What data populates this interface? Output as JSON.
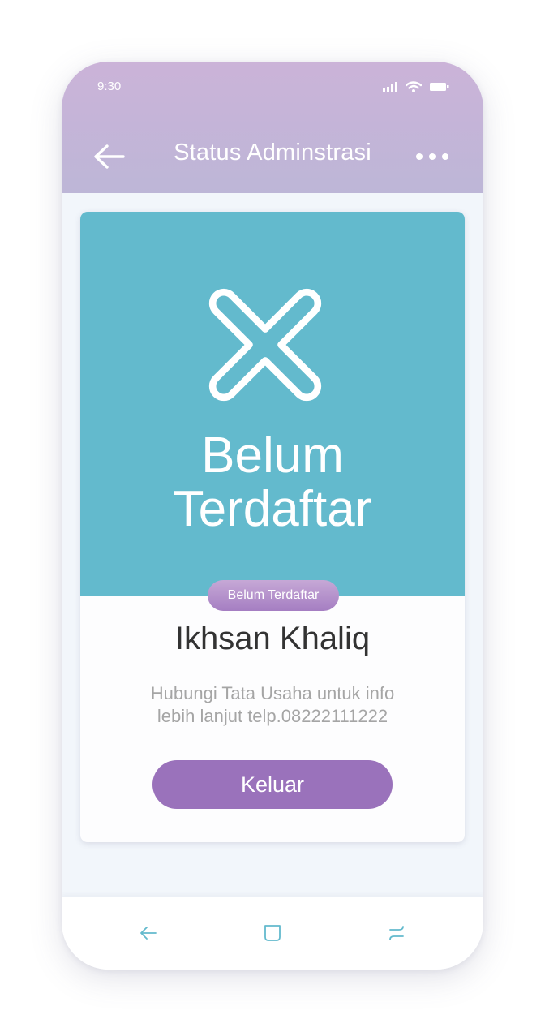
{
  "status_bar": {
    "time": "9:30",
    "icons": [
      "signal-icon",
      "wifi-icon",
      "battery-icon"
    ]
  },
  "header": {
    "title": "Status Adminstrasi",
    "back_icon": "arrow-left-icon",
    "menu_icon": "more-dots-icon"
  },
  "card": {
    "status_icon": "x-mark-icon",
    "status_title_line1": "Belum",
    "status_title_line2": "Terdaftar",
    "badge": "Belum Terdaftar",
    "user_name": "Ikhsan Khaliq",
    "info_line1": "Hubungi Tata Usaha untuk info",
    "info_line2": "lebih lanjut telp.08222111222",
    "logout_label": "Keluar"
  },
  "nav_bar": {
    "items": [
      "back-nav-icon",
      "home-nav-icon",
      "recent-apps-icon"
    ]
  },
  "colors": {
    "header_gradient_top": "#cbb3d8",
    "header_gradient_bottom": "#bdb6d7",
    "hero_background": "#63bacd",
    "accent_purple": "#9a72bb",
    "nav_icon": "#63bacd",
    "name_text": "#333333",
    "info_text": "#a5a5a5"
  }
}
